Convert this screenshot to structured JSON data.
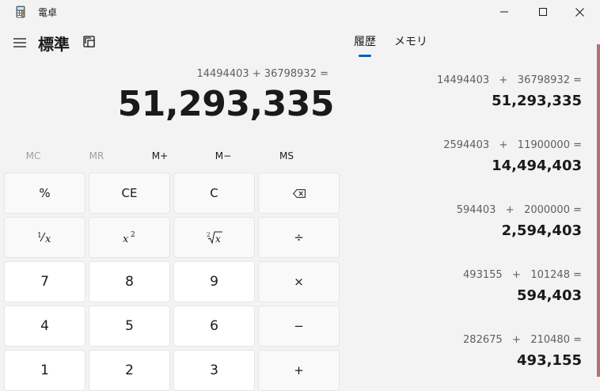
{
  "window": {
    "title": "電卓",
    "icon": "calculator-icon"
  },
  "header": {
    "mode": "標準",
    "menu_icon": "hamburger-icon",
    "keep_on_top_icon": "keep-on-top-icon"
  },
  "display": {
    "expression": "14494403 + 36798932 =",
    "value": "51,293,335"
  },
  "memory": {
    "buttons": [
      {
        "label": "MC",
        "enabled": false
      },
      {
        "label": "MR",
        "enabled": false
      },
      {
        "label": "M+",
        "enabled": true
      },
      {
        "label": "M−",
        "enabled": true
      },
      {
        "label": "MS",
        "enabled": true
      }
    ]
  },
  "keypad": {
    "row1": [
      "%",
      "CE",
      "C",
      "⌫"
    ],
    "row2_ops": [
      "÷"
    ],
    "row3": [
      "7",
      "8",
      "9",
      "×"
    ],
    "row4": [
      "4",
      "5",
      "6",
      "−"
    ],
    "row5": [
      "1",
      "2",
      "3",
      "+"
    ]
  },
  "panel": {
    "tabs": [
      {
        "label": "履歴",
        "active": true
      },
      {
        "label": "メモリ",
        "active": false
      }
    ],
    "history": [
      {
        "expression": "14494403   +   36798932 =",
        "result": "51,293,335"
      },
      {
        "expression": "2594403   +   11900000 =",
        "result": "14,494,403"
      },
      {
        "expression": "594403   +   2000000 =",
        "result": "2,594,403"
      },
      {
        "expression": "493155   +   101248 =",
        "result": "594,403"
      },
      {
        "expression": "282675   +   210480 =",
        "result": "493,155"
      }
    ]
  },
  "colors": {
    "accent": "#005fb8",
    "background": "#f3f3f3"
  }
}
